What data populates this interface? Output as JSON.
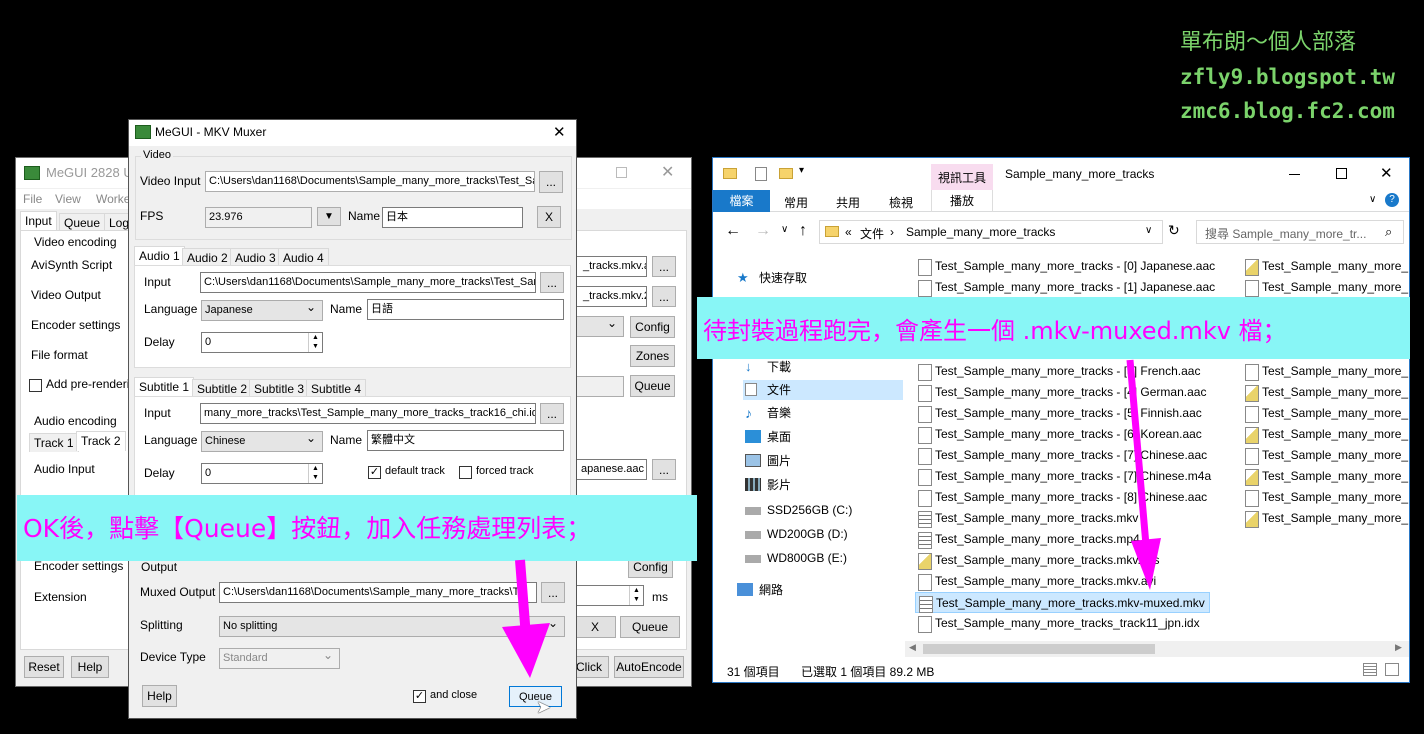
{
  "watermark": {
    "line1": "單布朗～個人部落",
    "line2": "zfly9.blogspot.tw",
    "line3": "zmc6.blog.fc2.com"
  },
  "megui_main": {
    "title": "MeGUI 2828 U",
    "menu": [
      "File",
      "View",
      "Worke"
    ],
    "tabs": [
      "Input",
      "Queue",
      "Log"
    ],
    "video_group": "Video encoding",
    "video_rows": [
      "AviSynth Script",
      "Video Output",
      "Encoder settings",
      "File format"
    ],
    "add_prerender": "Add pre-renderin",
    "right_boxes": [
      "_tracks.mkv.a",
      "_tracks.mkv.2"
    ],
    "btn_config": "Config",
    "btn_zones": "Zones",
    "btn_queue": "Queue",
    "audio_group": "Audio encoding",
    "audio_tabs": [
      "Track 1",
      "Track 2"
    ],
    "audio_input_label": "Audio Input",
    "audio_input_value": "apanese.aac",
    "encoder_settings": "Encoder settings",
    "extension": "Extension",
    "btn_config2": "Config",
    "ms": "ms",
    "btn_reset": "Reset",
    "btn_help": "Help",
    "btn_click": "Click",
    "btn_autoencode": "AutoEncode",
    "btn_x": "X",
    "btn_queue2": "Queue"
  },
  "muxer": {
    "title": "MeGUI - MKV Muxer",
    "video_group": "Video",
    "video_input_label": "Video Input",
    "video_input_value": "C:\\Users\\dan1168\\Documents\\Sample_many_more_tracks\\Test_Sa",
    "fps_label": "FPS",
    "fps_value": "23.976",
    "name_label": "Name",
    "video_name": "日本",
    "btn_x": "X",
    "audio_tabs": [
      "Audio 1",
      "Audio 2",
      "Audio 3",
      "Audio 4"
    ],
    "input_label": "Input",
    "audio_input_value": "C:\\Users\\dan1168\\Documents\\Sample_many_more_tracks\\Test_Sam",
    "language_label": "Language",
    "audio_language": "Japanese",
    "audio_name": "日語",
    "delay_label": "Delay",
    "audio_delay": "0",
    "subtitle_tabs": [
      "Subtitle 1",
      "Subtitle 2",
      "Subtitle 3",
      "Subtitle 4"
    ],
    "subtitle_input_value": "many_more_tracks\\Test_Sample_many_more_tracks_track16_chi.idx",
    "subtitle_language": "Chinese",
    "subtitle_name": "繁體中文",
    "subtitle_delay": "0",
    "default_track": "default track",
    "forced_track": "forced track",
    "output_group": "Output",
    "muxed_output_label": "Muxed Output",
    "muxed_output_value": "C:\\Users\\dan1168\\Documents\\Sample_many_more_tracks\\Te",
    "splitting_label": "Splitting",
    "splitting_value": "No splitting",
    "device_type_label": "Device Type",
    "device_type_value": "Standard",
    "btn_help": "Help",
    "and_close": "and close",
    "btn_queue": "Queue",
    "browse": "..."
  },
  "explorer": {
    "ribbon_context": "視訊工具",
    "title": "Sample_many_more_tracks",
    "tabs": [
      "檔案",
      "常用",
      "共用",
      "檢視",
      "播放"
    ],
    "breadcrumb": [
      "«",
      "文件",
      "›",
      "Sample_many_more_tracks"
    ],
    "search_placeholder": "搜尋 Sample_many_more_tr...",
    "nav": [
      "快速存取",
      "下載",
      "文件",
      "音樂",
      "桌面",
      "圖片",
      "影片",
      "SSD256GB (C:)",
      "WD200GB (D:)",
      "WD800GB (E:)",
      "網路"
    ],
    "files_col1": [
      "Test_Sample_many_more_tracks - [0] Japanese.aac",
      "Test_Sample_many_more_tracks - [1] Japanese.aac",
      "Test_Sample_many_more_tracks - [3] French.aac",
      "Test_Sample_many_more_tracks - [4] German.aac",
      "Test_Sample_many_more_tracks - [5] Finnish.aac",
      "Test_Sample_many_more_tracks - [6] Korean.aac",
      "Test_Sample_many_more_tracks - [7] Chinese.aac",
      "Test_Sample_many_more_tracks - [7] Chinese.m4a",
      "Test_Sample_many_more_tracks - [8] Chinese.aac",
      "Test_Sample_many_more_tracks.mkv",
      "Test_Sample_many_more_tracks.mp4",
      "Test_Sample_many_more_tracks.mkv.avs",
      "Test_Sample_many_more_tracks.mkv.avi",
      "Test_Sample_many_more_tracks.mkv-muxed.mkv",
      "Test_Sample_many_more_tracks_track11_jpn.idx"
    ],
    "files_col2": [
      "Test_Sample_many_more_",
      "Test_Sample_many_more_",
      "Test_Sample_many_more_",
      "Test_Sample_many_more_",
      "Test_Sample_many_more_",
      "Test_Sample_many_more_",
      "Test_Sample_many_more_",
      "Test_Sample_many_more_",
      "Test_Sample_many_more_",
      "Test_Sample_many_more_",
      "Test_Sample_many_more_",
      "Test_Sample_many_more_",
      "Test_Sample_many_more_"
    ],
    "status_count": "31 個項目",
    "status_selected": "已選取 1 個項目  89.2 MB"
  },
  "callouts": {
    "right": "待封裝過程跑完，會產生一個 .mkv-muxed.mkv 檔；",
    "left": "OK後，點擊【Queue】按鈕，加入任務處理列表；"
  },
  "colors": {
    "callout_bg": "#88f6f6",
    "callout_text": "#ff00ff",
    "watermark": "#7bd36b",
    "selection": "#cce8ff",
    "ribbon_blue": "#1979ca"
  }
}
